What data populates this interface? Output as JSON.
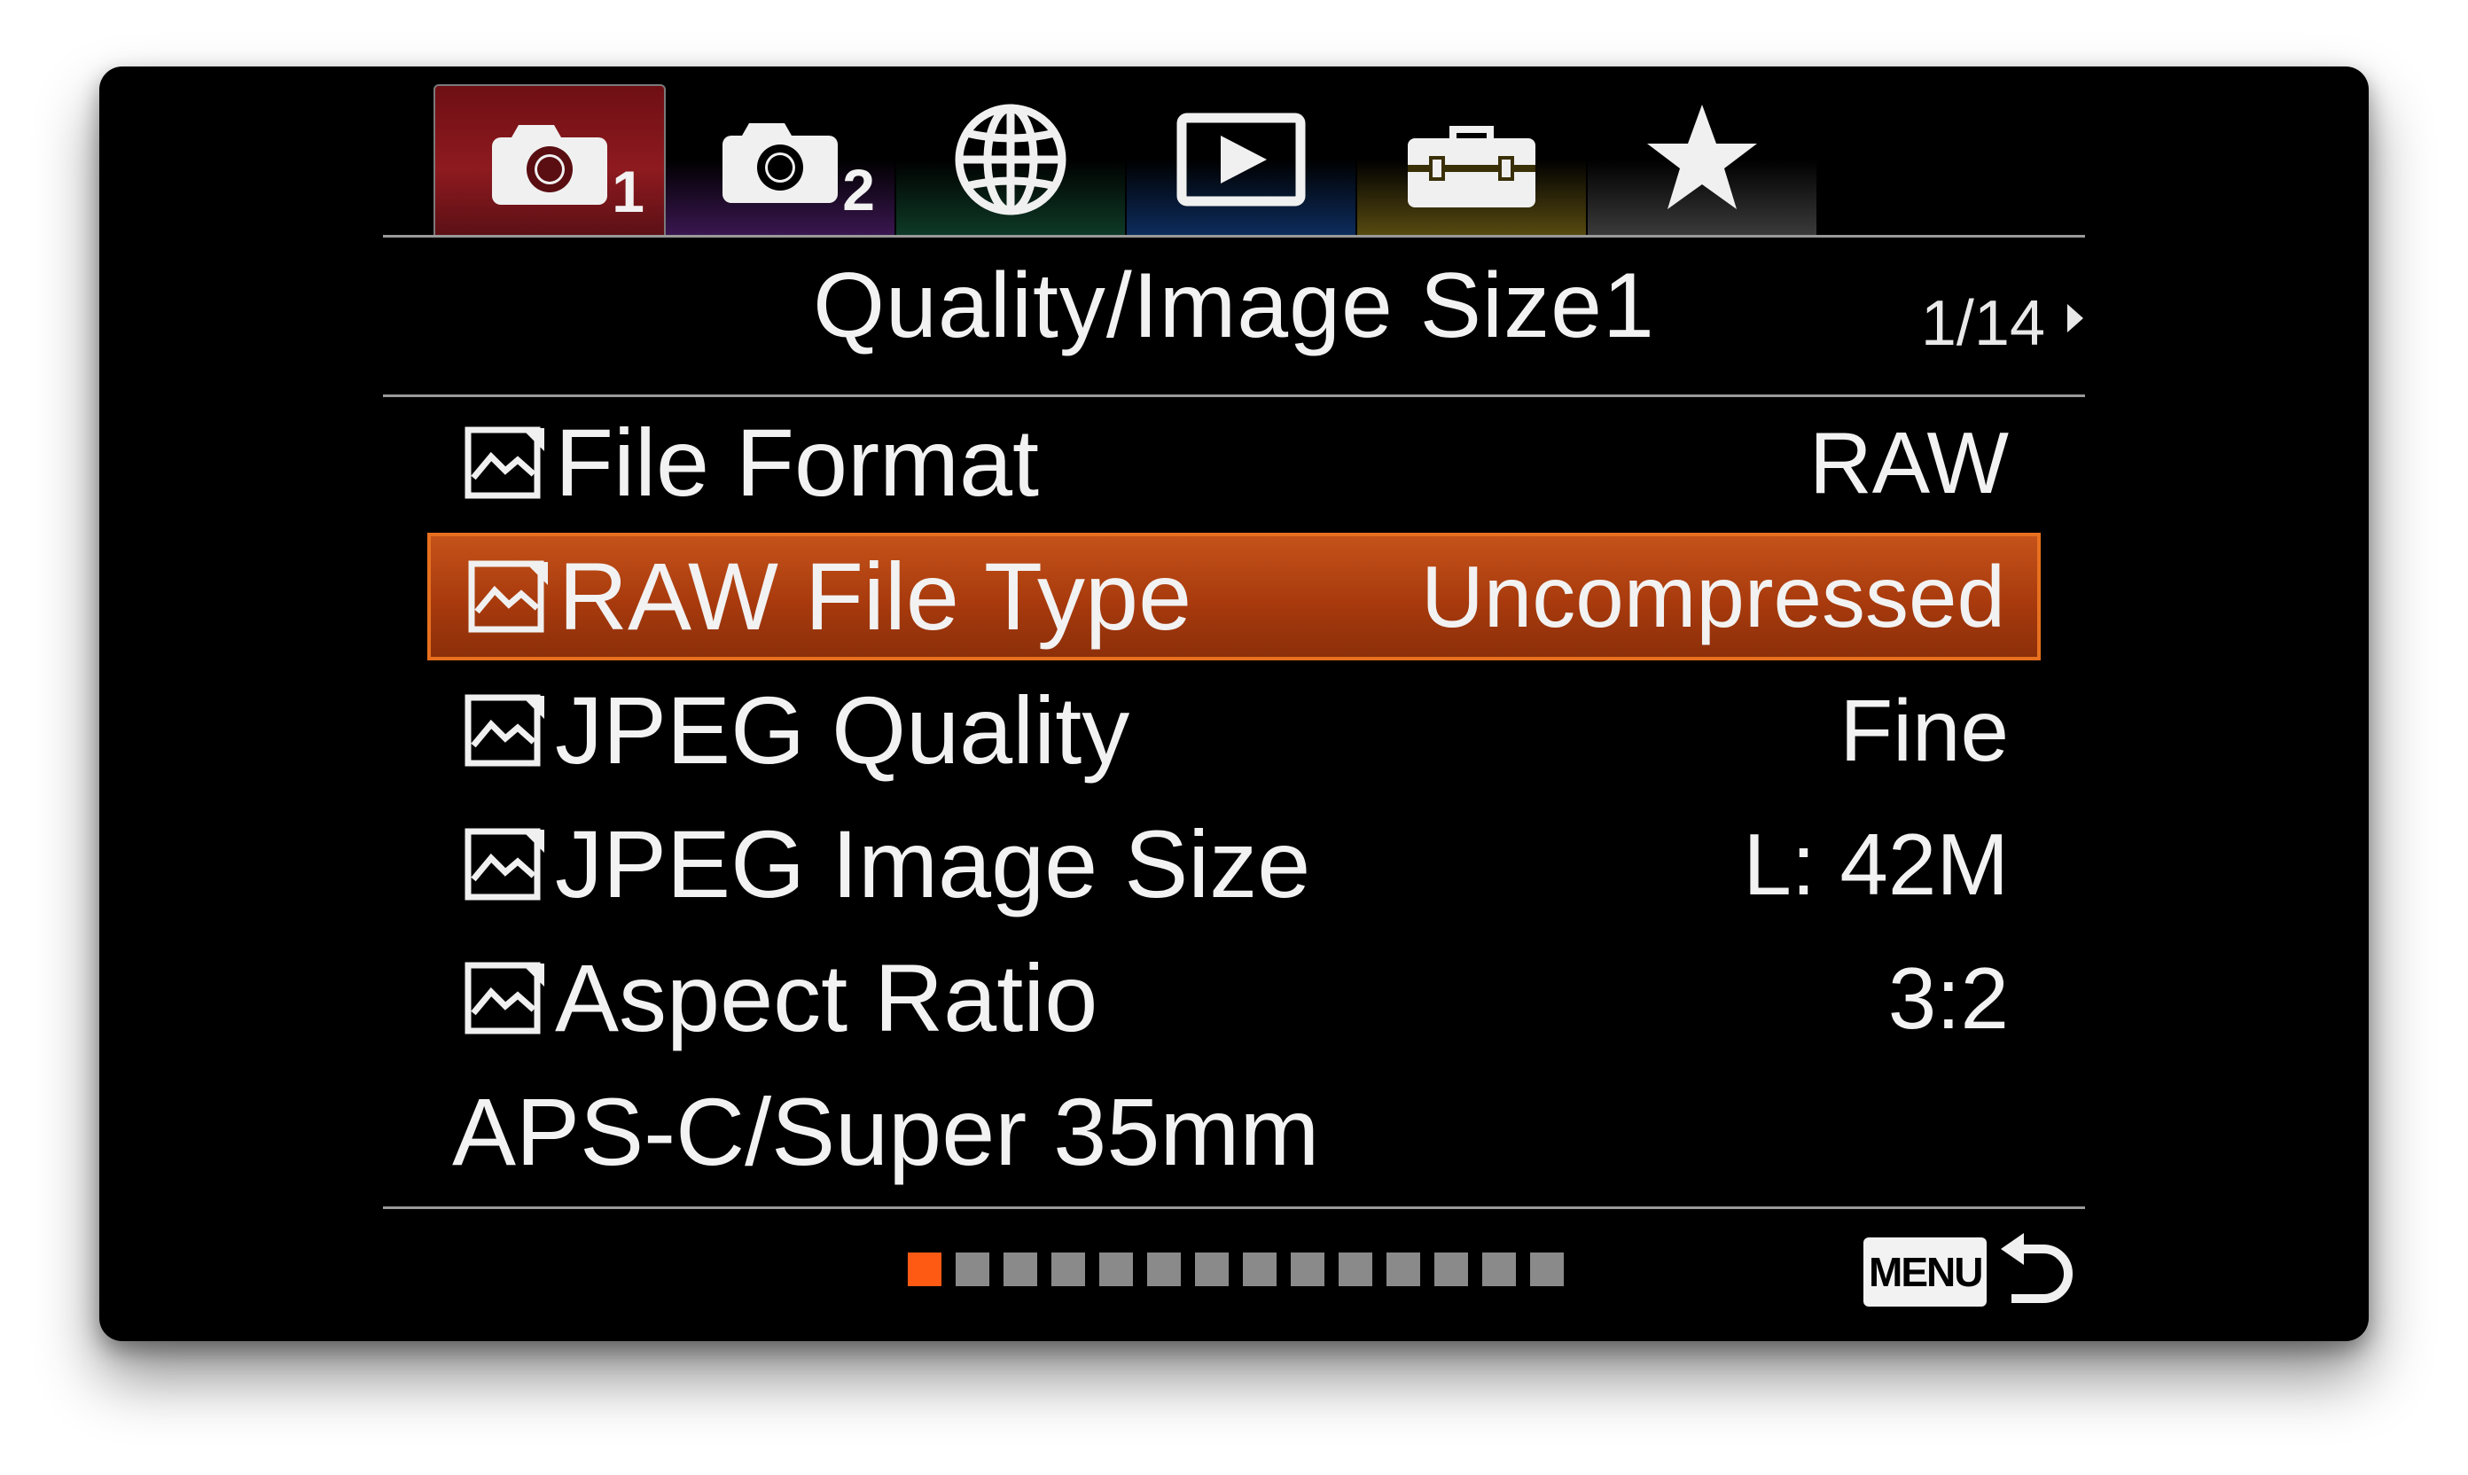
{
  "tabs": [
    {
      "id": "shooting-1",
      "icon": "camera-icon",
      "number": "1",
      "color": "#8e1a1f",
      "active": true
    },
    {
      "id": "shooting-2",
      "icon": "camera-icon",
      "number": "2",
      "color": "#3a1650",
      "active": false
    },
    {
      "id": "network",
      "icon": "globe-icon",
      "color": "#0e3a26",
      "active": false
    },
    {
      "id": "playback",
      "icon": "play-icon",
      "color": "#0d2c5c",
      "active": false
    },
    {
      "id": "setup",
      "icon": "toolbox-icon",
      "color": "#574a10",
      "active": false
    },
    {
      "id": "my-menu",
      "icon": "star-icon",
      "color": "#3a3a3a",
      "active": false
    }
  ],
  "header": {
    "title": "Quality/Image Size1",
    "page_counter": "1/14"
  },
  "menu": {
    "items": [
      {
        "label": "File Format",
        "value": "RAW",
        "icon": "still-image-icon"
      },
      {
        "label": "RAW File Type",
        "value": "Uncompressed",
        "icon": "still-image-icon",
        "selected": true
      },
      {
        "label": "JPEG Quality",
        "value": "Fine",
        "icon": "still-image-icon"
      },
      {
        "label": "JPEG Image Size",
        "value": "L: 42M",
        "icon": "still-image-icon"
      },
      {
        "label": "Aspect Ratio",
        "value": "3:2",
        "icon": "still-image-icon"
      },
      {
        "label": "APS-C/Super 35mm",
        "value": ""
      }
    ]
  },
  "pagination": {
    "total_pages": 14,
    "current_page": 1,
    "active_color": "#ff5a14"
  },
  "footer": {
    "menu_button_label": "MENU",
    "back_icon": "return-arrow-icon"
  },
  "colors": {
    "selection": "#b5430f",
    "selection_border": "#e8701e",
    "background": "#000000"
  }
}
